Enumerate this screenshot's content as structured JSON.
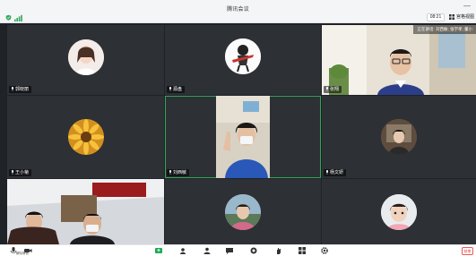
{
  "window": {
    "title": "腾讯会议",
    "minimize_label": "—"
  },
  "status": {
    "clock": "08:21",
    "view_label": "宫格视图"
  },
  "speaking": "正在讲话: 刘西敏; 张学孝; 董小",
  "tiles": [
    {
      "name": "郭晓丽"
    },
    {
      "name": "源盘"
    },
    {
      "name": "张翔"
    },
    {
      "name": "王小菊"
    },
    {
      "name": "刘西敏"
    },
    {
      "name": "杨文妍"
    },
    {
      "name": ""
    },
    {
      "name": ""
    },
    {
      "name": ""
    }
  ],
  "toolbar": {
    "mute_label": "解除静音",
    "end_label": "结束"
  },
  "colors": {
    "active_border": "#2fa85a",
    "stage_bg": "#1f2227",
    "end_red": "#e33333"
  },
  "icons": [
    "secure-icon",
    "signal-icon",
    "grid-view-icon",
    "mic-icon",
    "camera-icon",
    "share-icon",
    "members-icon",
    "chat-icon",
    "record-icon",
    "hand-icon",
    "apps-icon",
    "settings-icon"
  ]
}
